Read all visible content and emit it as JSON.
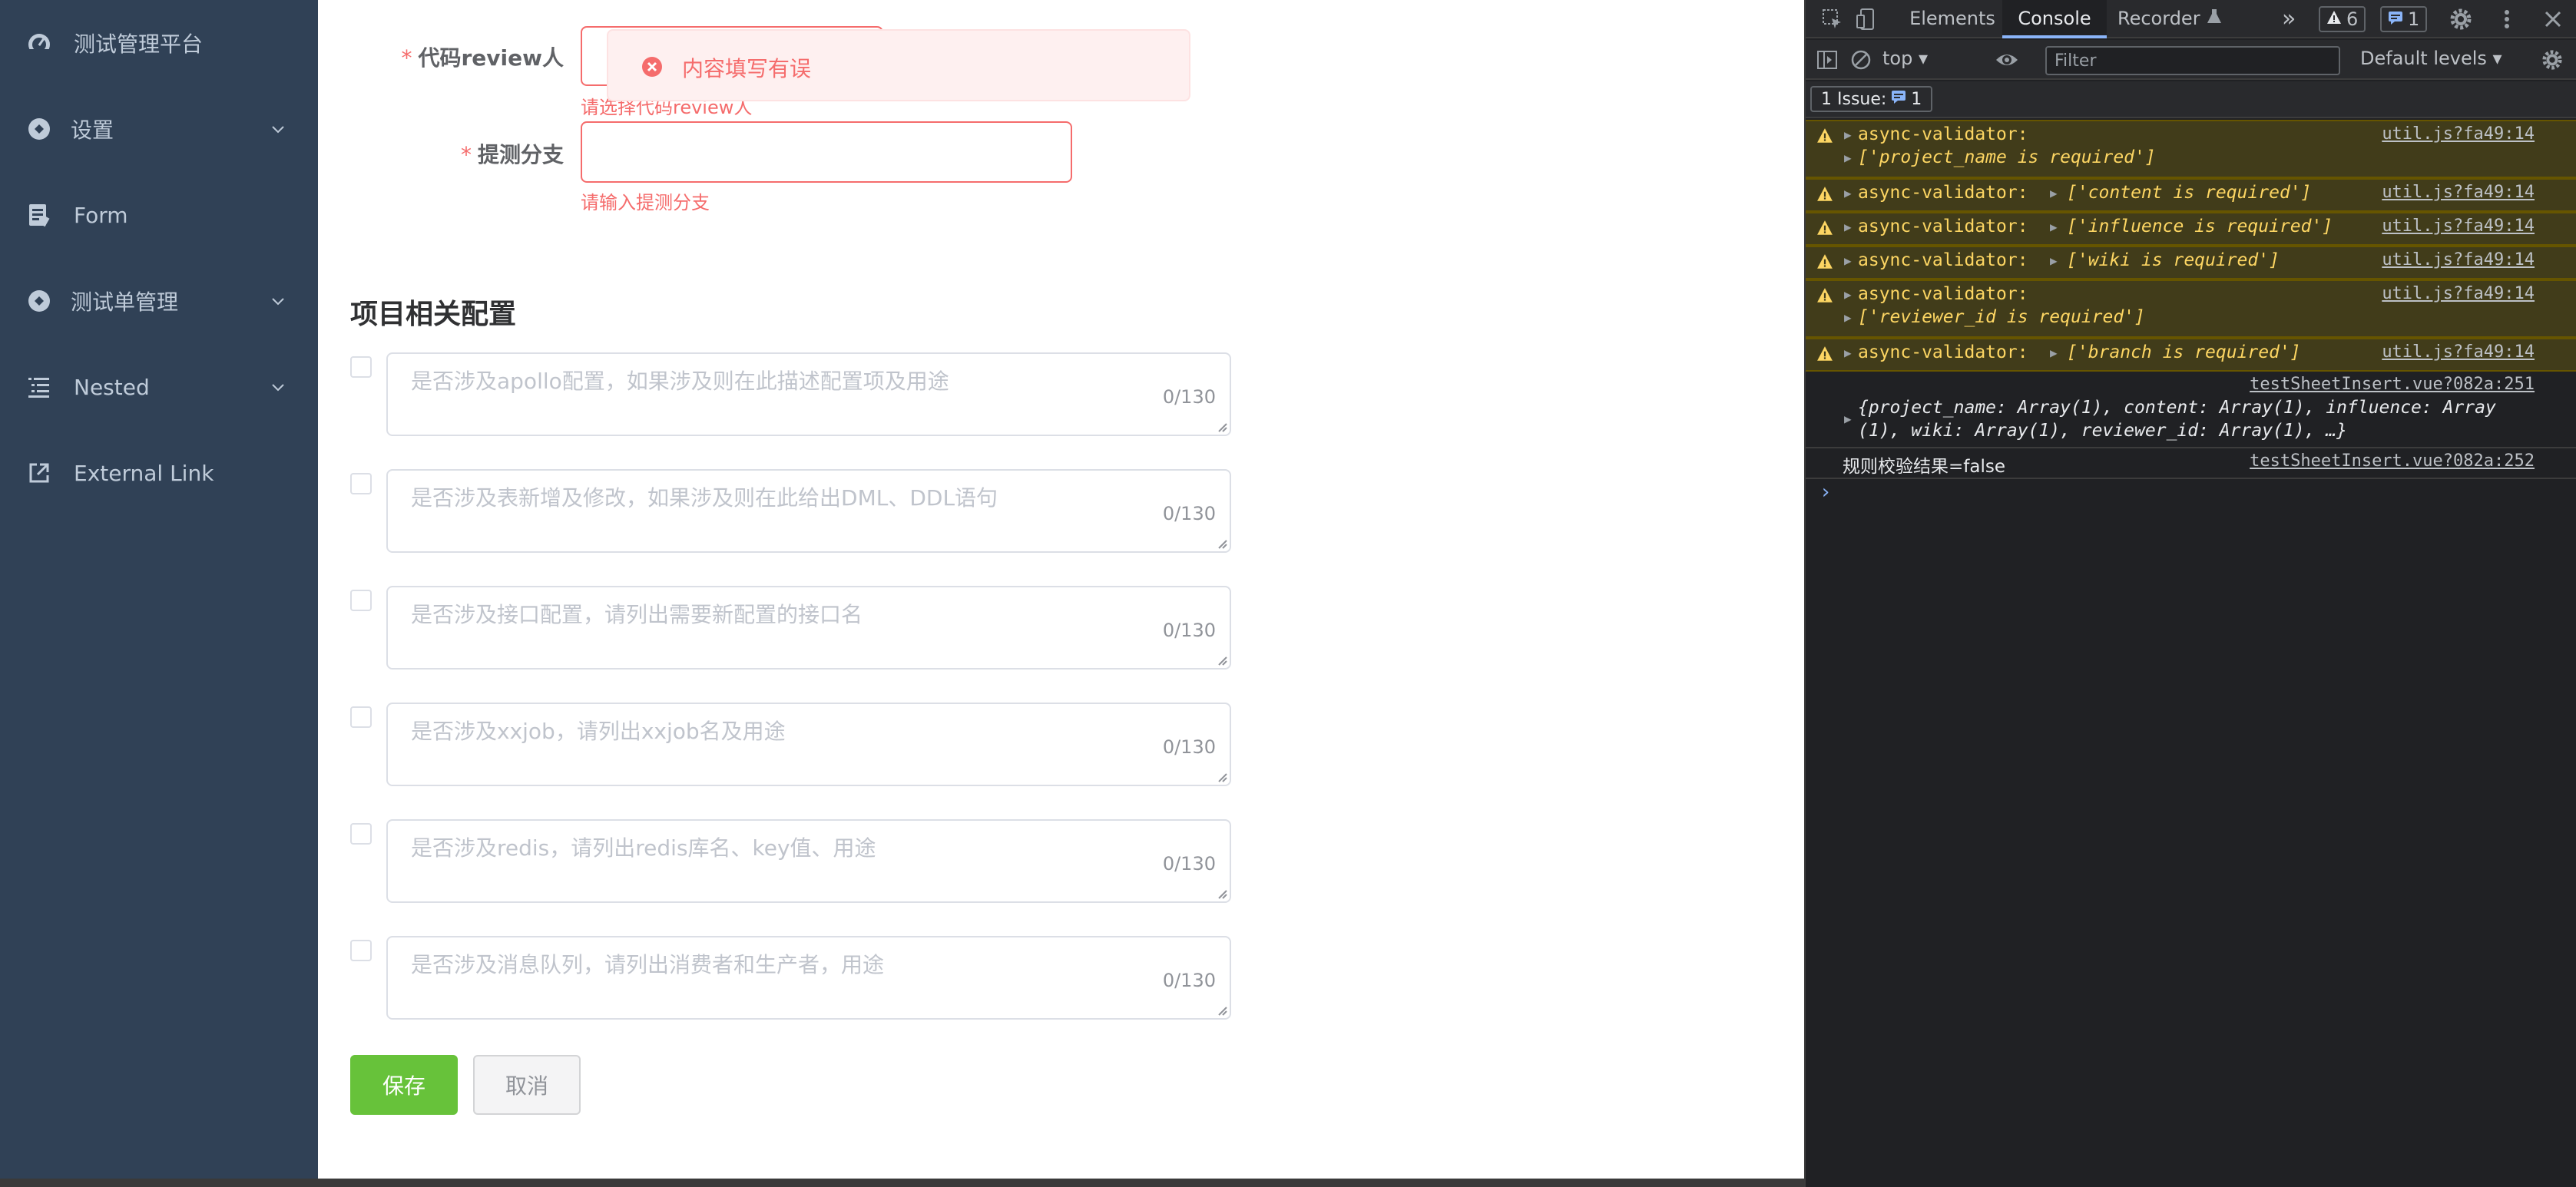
{
  "sidebar": {
    "items": [
      {
        "label": "测试管理平台",
        "icon": "dashboard-icon",
        "has_arrow": false
      },
      {
        "label": "设置",
        "icon": "settings-icon",
        "has_arrow": true
      },
      {
        "label": "Form",
        "icon": "form-icon",
        "has_arrow": false
      },
      {
        "label": "测试单管理",
        "icon": "settings-icon",
        "has_arrow": true
      },
      {
        "label": "Nested",
        "icon": "nested-list-icon",
        "has_arrow": true
      },
      {
        "label": "External Link",
        "icon": "external-link-icon",
        "has_arrow": false
      }
    ]
  },
  "form": {
    "reviewer": {
      "required_mark": "*",
      "label": "代码review人",
      "error": "请选择代码review人"
    },
    "branch": {
      "required_mark": "*",
      "label": "提测分支",
      "error": "请输入提测分支"
    },
    "section_title": "项目相关配置",
    "config_rows": [
      {
        "placeholder": "是否涉及apollo配置，如果涉及则在此描述配置项及用途",
        "count": "0/130"
      },
      {
        "placeholder": "是否涉及表新增及修改，如果涉及则在此给出DML、DDL语句",
        "count": "0/130"
      },
      {
        "placeholder": "是否涉及接口配置，请列出需要新配置的接口名",
        "count": "0/130"
      },
      {
        "placeholder": "是否涉及xxjob，请列出xxjob名及用途",
        "count": "0/130"
      },
      {
        "placeholder": "是否涉及redis，请列出redis库名、key值、用途",
        "count": "0/130"
      },
      {
        "placeholder": "是否涉及消息队列，请列出消费者和生产者，用途",
        "count": "0/130"
      }
    ],
    "save_label": "保存",
    "cancel_label": "取消"
  },
  "toast": {
    "message": "内容填写有误"
  },
  "devtools": {
    "tabs": {
      "elements": "Elements",
      "console": "Console",
      "recorder": "Recorder",
      "more": "»",
      "warn_count": "6",
      "info_count": "1"
    },
    "toolbar": {
      "context": "top",
      "filter_placeholder": "Filter",
      "levels": "Default levels"
    },
    "issues": {
      "label": "1 Issue:",
      "count": "1"
    },
    "logs": [
      {
        "text": "async-validator:",
        "arr": "['project_name is required']",
        "src": "util.js?fa49:14"
      },
      {
        "text": "async-validator:",
        "arr": "['content is required']",
        "src": "util.js?fa49:14"
      },
      {
        "text": "async-validator:",
        "arr": "['influence is required']",
        "src": "util.js?fa49:14"
      },
      {
        "text": "async-validator:",
        "arr": "['wiki is required']",
        "src": "util.js?fa49:14"
      },
      {
        "text": "async-validator:",
        "arr": "['reviewer_id is required']",
        "src": "util.js?fa49:14"
      },
      {
        "text": "async-validator:",
        "arr": "['branch is required']",
        "src": "util.js?fa49:14"
      }
    ],
    "object_log": {
      "src": "testSheetInsert.vue?082a:251",
      "line1": "{project_name: Array(1), content: Array(1), influence: Array",
      "line2": "(1), wiki: Array(1), reviewer_id: Array(1), …}"
    },
    "result_log": {
      "text": "规则校验结果=false",
      "src": "testSheetInsert.vue?082a:252"
    },
    "prompt": "›"
  },
  "colors": {
    "sidebar_bg": "#304156",
    "error": "#f56c6c",
    "success": "#67c23a",
    "devtools_bg": "#202124",
    "warn_bg": "#413c1a"
  }
}
